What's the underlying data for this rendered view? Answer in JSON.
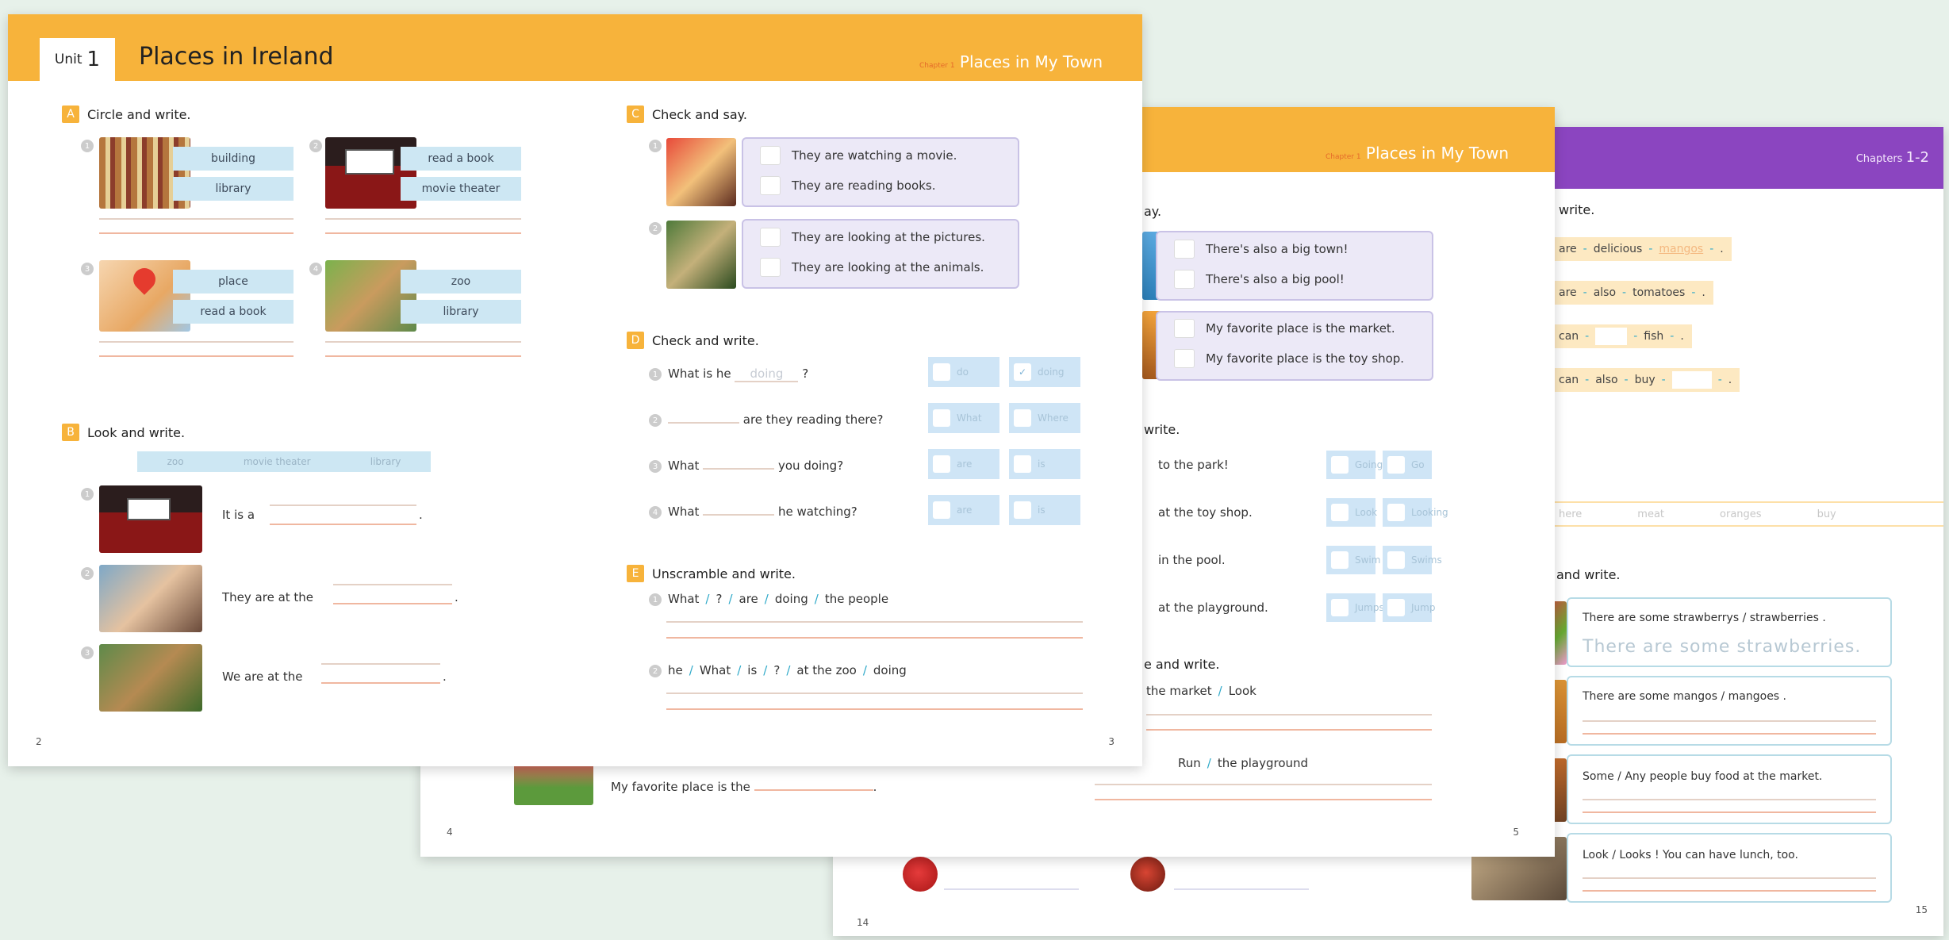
{
  "colors": {
    "background": "#e7f1ea",
    "header_orange": "#f7b33b",
    "header_purple": "#8b45c0",
    "pill_blue": "#cde7f3",
    "check_lavender": "#ece9f7",
    "check_blue": "#cfe5f6",
    "chip_yellow": "#fde9c2"
  },
  "front": {
    "unit_label": "Unit",
    "unit_number": "1",
    "title": "Places in Ireland",
    "chapter_tag": "Chapter 1",
    "chapter_title": "Places in My Town",
    "left": {
      "sec_a": {
        "letter": "A",
        "label": "Circle and write."
      },
      "a_items": [
        {
          "words": [
            "building",
            "library"
          ]
        },
        {
          "words": [
            "read a book",
            "movie theater"
          ]
        },
        {
          "words": [
            "place",
            "read a book"
          ]
        },
        {
          "words": [
            "zoo",
            "library"
          ]
        }
      ],
      "sec_b": {
        "letter": "B",
        "label": "Look and write."
      },
      "word_bank": [
        "zoo",
        "movie theater",
        "library"
      ],
      "b_items": [
        {
          "prefix": "It is a",
          "suffix": "."
        },
        {
          "prefix": "They are at the",
          "suffix": "."
        },
        {
          "prefix": "We are at the",
          "suffix": "."
        }
      ],
      "page_number": "2"
    },
    "right": {
      "sec_c": {
        "letter": "C",
        "label": "Check and say."
      },
      "c_items": [
        [
          "They are watching a movie.",
          "They are reading books."
        ],
        [
          "They are looking at the pictures.",
          "They are looking at the animals."
        ]
      ],
      "sec_d": {
        "letter": "D",
        "label": "Check and write."
      },
      "d_items": [
        {
          "q": "What is he",
          "answer": "doing",
          "end": "?",
          "opts": [
            "do",
            "doing"
          ]
        },
        {
          "q": "are they reading there?",
          "opts": [
            "What",
            "Where"
          ]
        },
        {
          "q": "What",
          "q2": "you doing?",
          "opts": [
            "are",
            "is"
          ]
        },
        {
          "q": "What",
          "q2": "he watching?",
          "opts": [
            "are",
            "is"
          ]
        }
      ],
      "sec_e": {
        "letter": "E",
        "label": "Unscramble and write."
      },
      "e_items": [
        [
          "What",
          "?",
          "are",
          "doing",
          "the people"
        ],
        [
          "he",
          "What",
          "is",
          "?",
          "at the zoo",
          "doing"
        ]
      ],
      "page_number": "3"
    }
  },
  "middle": {
    "chapter_tag": "Chapter 1",
    "chapter_title": "Places in My Town",
    "say_label": "ay.",
    "c_items": [
      [
        "There's also a big town!",
        "There's also a big pool!"
      ],
      [
        "My favorite place is the market.",
        "My favorite place is the toy shop."
      ]
    ],
    "write_label": "write.",
    "d_items": [
      {
        "text": "to the park!",
        "opts": [
          "Going",
          "Go"
        ]
      },
      {
        "text": "at the toy shop.",
        "opts": [
          "Look",
          "Looking"
        ]
      },
      {
        "text": "in the pool.",
        "opts": [
          "Swim",
          "Swims"
        ]
      },
      {
        "text": "at the playground.",
        "opts": [
          "Jumps",
          "Jump"
        ]
      }
    ],
    "e_label": "e and write.",
    "e_items": [
      "the market",
      "Look"
    ],
    "e_items2": [
      "Run",
      "the playground"
    ],
    "favorite_prefix": "My favorite place is the",
    "favorite_suffix": ".",
    "page_left": "4",
    "page_right": "5"
  },
  "back": {
    "chapters_tag": "Chapters",
    "chapters_range": "1-2",
    "write_label": "write.",
    "rows": [
      [
        "are",
        "delicious",
        "mangos",
        "."
      ],
      [
        "are",
        "also",
        "tomatoes",
        "."
      ],
      [
        "can",
        "",
        "fish",
        "."
      ],
      [
        "can",
        "also",
        "buy",
        "",
        "."
      ]
    ],
    "bank": [
      "here",
      "meat",
      "oranges",
      "buy"
    ],
    "and_write_label": "and write.",
    "sentences": [
      {
        "text": "There are some  strawberrys / strawberries .",
        "trace": "There are some strawberries."
      },
      {
        "text": "There are some  mangos / mangoes .",
        "trace": ""
      },
      {
        "text": "Some / Any  people buy food at the market.",
        "trace": ""
      },
      {
        "text": "Look / Looks ! You can have lunch, too.",
        "trace": ""
      }
    ],
    "page_left": "14",
    "page_right": "15"
  }
}
